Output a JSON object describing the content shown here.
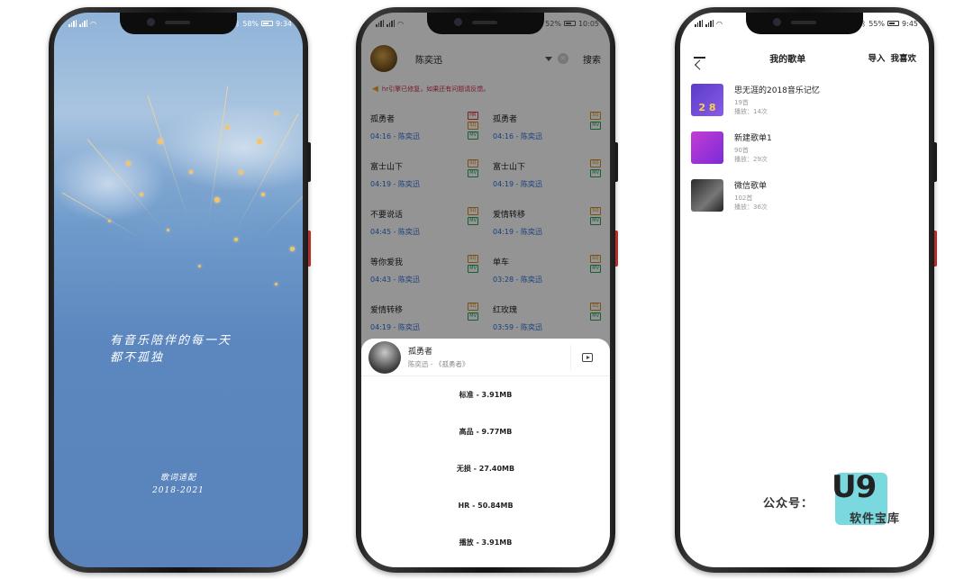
{
  "phone1": {
    "status": {
      "battery": "58%",
      "time": "9:34"
    },
    "quote_line1": "有音乐陪伴的每一天",
    "quote_line2": "都不孤独",
    "brand_name": "歌词适配",
    "brand_years": "2018-2021"
  },
  "phone2": {
    "status": {
      "battery": "52%",
      "time": "10:05"
    },
    "search_value": "陈奕迅",
    "search_button": "搜索",
    "notice": "hr引擎已修复，如果还有问题请反馈。",
    "songs": [
      {
        "title": "孤勇者",
        "meta": "04:16 - 陈奕迅",
        "tags": [
          "HR",
          "SQ",
          "MV"
        ]
      },
      {
        "title": "孤勇者",
        "meta": "04:16 - 陈奕迅",
        "tags": [
          "SQ",
          "MV"
        ]
      },
      {
        "title": "富士山下",
        "meta": "04:19 - 陈奕迅",
        "tags": [
          "SQ",
          "MV"
        ]
      },
      {
        "title": "富士山下",
        "meta": "04:19 - 陈奕迅",
        "tags": [
          "SQ",
          "MV"
        ]
      },
      {
        "title": "不要说话",
        "meta": "04:45 - 陈奕迅",
        "tags": [
          "SQ",
          "MV"
        ]
      },
      {
        "title": "爱情转移",
        "meta": "04:19 - 陈奕迅",
        "tags": [
          "SQ",
          "MV"
        ]
      },
      {
        "title": "等你爱我",
        "meta": "04:43 - 陈奕迅",
        "tags": [
          "SQ",
          "MV"
        ]
      },
      {
        "title": "单车",
        "meta": "03:28 - 陈奕迅",
        "tags": [
          "SQ",
          "MV"
        ]
      },
      {
        "title": "爱情转移",
        "meta": "04:19 - 陈奕迅",
        "tags": [
          "SQ",
          "MV"
        ]
      },
      {
        "title": "红玫瑰",
        "meta": "03:59 - 陈奕迅",
        "tags": [
          "SQ",
          "MV"
        ]
      }
    ],
    "sheet": {
      "title": "孤勇者",
      "subtitle": "陈奕迅 - 《孤勇者》",
      "options": [
        "标准 - 3.91MB",
        "高品 - 9.77MB",
        "无损 - 27.40MB",
        "HR - 50.84MB",
        "播放 - 3.91MB"
      ]
    }
  },
  "phone3": {
    "status": {
      "battery": "55%",
      "time": "9:45"
    },
    "title": "我的歌单",
    "import_label": "导入",
    "favorites_label": "我喜欢",
    "playlists": [
      {
        "name": "思无涯的2018音乐记忆",
        "count": "19首",
        "plays": "播放：14次"
      },
      {
        "name": "新建歌单1",
        "count": "90首",
        "plays": "播放：29次"
      },
      {
        "name": "微信歌单",
        "count": "102首",
        "plays": "播放：36次"
      }
    ],
    "watermark": {
      "prefix": "公众号：",
      "logo": "U9",
      "sub": "软件宝库"
    }
  }
}
